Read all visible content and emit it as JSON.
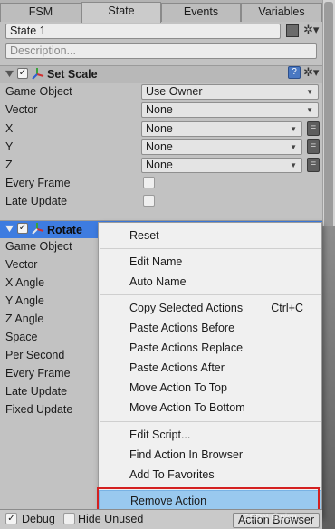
{
  "tabs": [
    "FSM",
    "State",
    "Events",
    "Variables"
  ],
  "state_name": "State 1",
  "description_placeholder": "Description...",
  "colors": {
    "highlight": "#99c9ef",
    "selected_header": "#3e7ce0",
    "annotation_box": "#d42020"
  },
  "set_scale": {
    "title": "Set Scale",
    "fields": [
      {
        "label": "Game Object",
        "value": "Use Owner"
      },
      {
        "label": "Vector",
        "value": "None"
      },
      {
        "label": "X",
        "value": "None"
      },
      {
        "label": "Y",
        "value": "None"
      },
      {
        "label": "Z",
        "value": "None"
      },
      {
        "label": "Every Frame",
        "value": ""
      },
      {
        "label": "Late Update",
        "value": ""
      }
    ]
  },
  "rotate": {
    "title": "Rotate",
    "fields": [
      "Game Object",
      "Vector",
      "X Angle",
      "Y Angle",
      "Z Angle",
      "Space",
      "Per Second",
      "Every Frame",
      "Late Update",
      "Fixed Update"
    ]
  },
  "context_menu": {
    "items": [
      {
        "label": "Reset",
        "shortcut": ""
      },
      {
        "label": "Edit Name",
        "shortcut": ""
      },
      {
        "label": "Auto Name",
        "shortcut": ""
      },
      {
        "label": "Copy Selected Actions",
        "shortcut": "Ctrl+C"
      },
      {
        "label": "Paste Actions Before",
        "shortcut": ""
      },
      {
        "label": "Paste Actions Replace",
        "shortcut": ""
      },
      {
        "label": "Paste Actions After",
        "shortcut": ""
      },
      {
        "label": "Move Action To Top",
        "shortcut": ""
      },
      {
        "label": "Move Action To Bottom",
        "shortcut": ""
      },
      {
        "label": "Edit Script...",
        "shortcut": ""
      },
      {
        "label": "Find Action In Browser",
        "shortcut": ""
      },
      {
        "label": "Add To Favorites",
        "shortcut": ""
      },
      {
        "label": "Remove Action",
        "shortcut": ""
      }
    ]
  },
  "bottom": {
    "debug_label": "Debug",
    "hide_unused_label": "Hide Unused",
    "action_browser_label": "Action Browser",
    "watermark": "CSDN @nico..."
  }
}
